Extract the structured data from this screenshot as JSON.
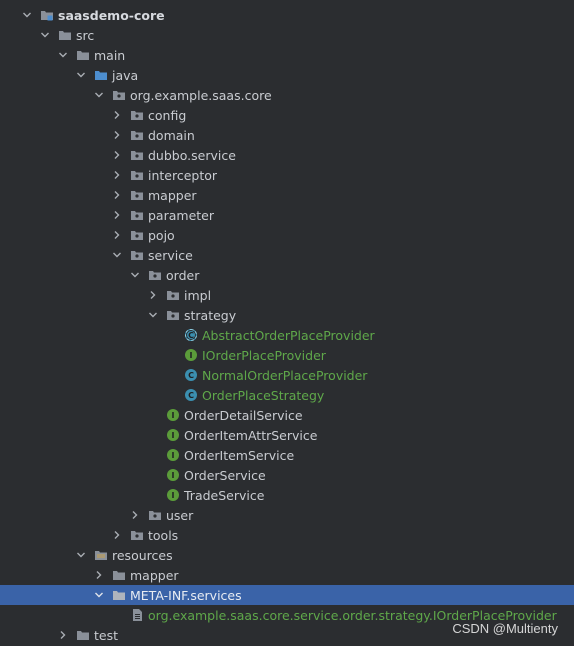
{
  "tree": {
    "nodes": [
      {
        "id": "saasdemo-core",
        "label": "saasdemo-core",
        "expanded": true,
        "icon": "module-folder-icon"
      },
      {
        "id": "src",
        "label": "src",
        "expanded": true,
        "icon": "folder-icon"
      },
      {
        "id": "main",
        "label": "main",
        "expanded": true,
        "icon": "folder-icon"
      },
      {
        "id": "java",
        "label": "java",
        "expanded": true,
        "icon": "source-root-folder-icon"
      },
      {
        "id": "org-example-saas-core",
        "label": "org.example.saas.core",
        "expanded": true,
        "icon": "package-icon"
      },
      {
        "id": "config",
        "label": "config",
        "expanded": false,
        "icon": "package-icon"
      },
      {
        "id": "domain",
        "label": "domain",
        "expanded": false,
        "icon": "package-icon"
      },
      {
        "id": "dubbo-service",
        "label": "dubbo.service",
        "expanded": false,
        "icon": "package-icon"
      },
      {
        "id": "interceptor",
        "label": "interceptor",
        "expanded": false,
        "icon": "package-icon"
      },
      {
        "id": "mapper",
        "label": "mapper",
        "expanded": false,
        "icon": "package-icon"
      },
      {
        "id": "parameter",
        "label": "parameter",
        "expanded": false,
        "icon": "package-icon"
      },
      {
        "id": "pojo",
        "label": "pojo",
        "expanded": false,
        "icon": "package-icon"
      },
      {
        "id": "service",
        "label": "service",
        "expanded": true,
        "icon": "package-icon"
      },
      {
        "id": "order",
        "label": "order",
        "expanded": true,
        "icon": "package-icon"
      },
      {
        "id": "impl",
        "label": "impl",
        "expanded": false,
        "icon": "package-icon"
      },
      {
        "id": "strategy",
        "label": "strategy",
        "expanded": true,
        "icon": "package-icon"
      },
      {
        "id": "AbstractOrderPlaceProvider",
        "label": "AbstractOrderPlaceProvider",
        "icon": "abstract-class-icon",
        "badge": "C"
      },
      {
        "id": "IOrderPlaceProvider",
        "label": "IOrderPlaceProvider",
        "icon": "interface-icon",
        "badge": "I"
      },
      {
        "id": "NormalOrderPlaceProvider",
        "label": "NormalOrderPlaceProvider",
        "icon": "class-icon",
        "badge": "C"
      },
      {
        "id": "OrderPlaceStrategy",
        "label": "OrderPlaceStrategy",
        "icon": "class-icon",
        "badge": "C"
      },
      {
        "id": "OrderDetailService",
        "label": "OrderDetailService",
        "icon": "interface-icon",
        "badge": "I"
      },
      {
        "id": "OrderItemAttrService",
        "label": "OrderItemAttrService",
        "icon": "interface-icon",
        "badge": "I"
      },
      {
        "id": "OrderItemService",
        "label": "OrderItemService",
        "icon": "interface-icon",
        "badge": "I"
      },
      {
        "id": "OrderService",
        "label": "OrderService",
        "icon": "interface-icon",
        "badge": "I"
      },
      {
        "id": "TradeService",
        "label": "TradeService",
        "icon": "interface-icon",
        "badge": "I"
      },
      {
        "id": "user",
        "label": "user",
        "expanded": false,
        "icon": "package-icon"
      },
      {
        "id": "tools",
        "label": "tools",
        "expanded": false,
        "icon": "package-icon"
      },
      {
        "id": "resources",
        "label": "resources",
        "expanded": true,
        "icon": "resources-folder-icon"
      },
      {
        "id": "mapper-res",
        "label": "mapper",
        "expanded": false,
        "icon": "folder-icon"
      },
      {
        "id": "META-INF-services",
        "label": "META-INF.services",
        "expanded": true,
        "icon": "folder-icon",
        "selected": true
      },
      {
        "id": "spi-file",
        "label": "org.example.saas.core.service.order.strategy.IOrderPlaceProvider",
        "icon": "file-icon"
      },
      {
        "id": "test",
        "label": "test",
        "expanded": false,
        "icon": "folder-icon"
      }
    ]
  },
  "watermark": "CSDN @Multienty",
  "colors": {
    "background": "#2b2d30",
    "selection": "#3a63a8",
    "text": "#c9ccd1",
    "green_text": "#5fa84a",
    "folder": "#8a9099",
    "source_folder": "#4d8ecf",
    "interface_badge": "#5b9c3a",
    "class_badge": "#3b8fb0"
  }
}
